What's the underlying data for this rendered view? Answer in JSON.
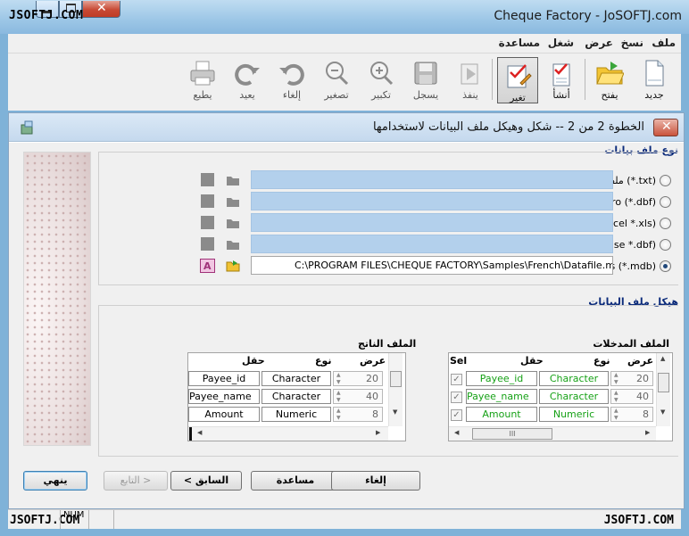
{
  "window": {
    "title": "Cheque Factory - JoSOFTJ.com",
    "watermark": "JSOFTJ.COM"
  },
  "menu": [
    "ملف",
    "نسخ",
    "عرض",
    "شغل",
    "مساعدة"
  ],
  "toolbar": {
    "new": "جديد",
    "open": "يفتح",
    "create": "أنشأ",
    "change": "تغير",
    "execute": "ينفذ",
    "save": "يسجل",
    "zoom_in": "تكبير",
    "zoom_out": "تصغير",
    "undo": "إلغاء",
    "redo": "يعيد",
    "print": "يطبع"
  },
  "dialog": {
    "title": "الخطوة 2 من 2 -- شكل وهيكل ملف البيانات لاستخدامها",
    "file_type_label": "نوع ملف بيانات",
    "file_types": [
      {
        "label": "ملف النص (*.txt)",
        "selected": false
      },
      {
        "label": "ملف Visual FoxPro (*.dbf)",
        "selected": false
      },
      {
        "label": "ملف Excel *.xls)",
        "selected": false
      },
      {
        "label": "ملف Dbase *.dbf)",
        "selected": false
      },
      {
        "label": "قاعدة MS Access (*.mdb)",
        "selected": true
      }
    ],
    "path": "C:\\PROGRAM FILES\\CHEQUE FACTORY\\Samples\\French\\Datafile.mdb",
    "structure_label": "هيكل ملف البيانات",
    "input_file_label": "الملف المدخلات",
    "output_file_label": "الملف الناتج",
    "columns": {
      "sel": "Sel",
      "field": "حقل",
      "type": "نوع",
      "width": "عرض"
    },
    "input_rows": [
      {
        "field": "Payee_id",
        "type": "Character",
        "width": "20"
      },
      {
        "field": "Payee_name",
        "type": "Character",
        "width": "40"
      },
      {
        "field": "Amount",
        "type": "Numeric",
        "width": "8"
      }
    ],
    "output_rows": [
      {
        "field": "Payee_id",
        "type": "Character",
        "width": "20"
      },
      {
        "field": "Payee_name",
        "type": "Character",
        "width": "40"
      },
      {
        "field": "Amount",
        "type": "Numeric",
        "width": "8"
      }
    ],
    "buttons": {
      "finish": "ينهي",
      "next": "التابع >",
      "back": "< السابق",
      "help": "مساعدة",
      "cancel": "إلغاء"
    }
  },
  "statusbar": {
    "num": "NUM"
  }
}
